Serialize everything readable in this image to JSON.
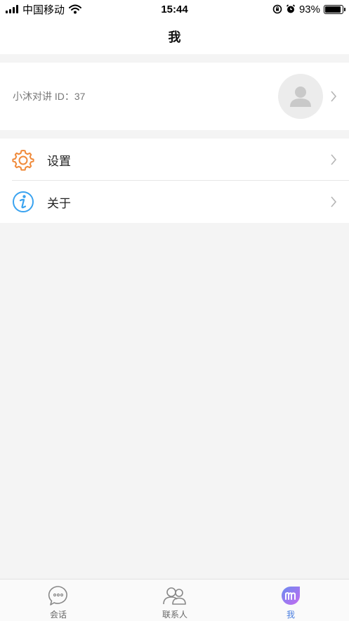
{
  "status_bar": {
    "carrier": "中国移动",
    "time": "15:44",
    "battery_percent": "93%",
    "battery_level": 0.93
  },
  "nav": {
    "title": "我"
  },
  "profile": {
    "id_text": "小沐对讲 ID：37",
    "avatar_icon": "user-placeholder-icon"
  },
  "menu": {
    "items": [
      {
        "label": "设置",
        "icon": "gear-icon",
        "color": "#f08a3a"
      },
      {
        "label": "关于",
        "icon": "info-icon",
        "color": "#3aa3f0"
      }
    ]
  },
  "tab_bar": {
    "tabs": [
      {
        "label": "会话",
        "icon": "chat-bubble-icon",
        "active": false
      },
      {
        "label": "联系人",
        "icon": "contacts-icon",
        "active": false
      },
      {
        "label": "我",
        "icon": "me-m-icon",
        "active": true
      }
    ]
  },
  "colors": {
    "background": "#f4f4f4",
    "accent": "#4a7fe0",
    "gear": "#f08a3a",
    "info": "#3aa3f0"
  }
}
